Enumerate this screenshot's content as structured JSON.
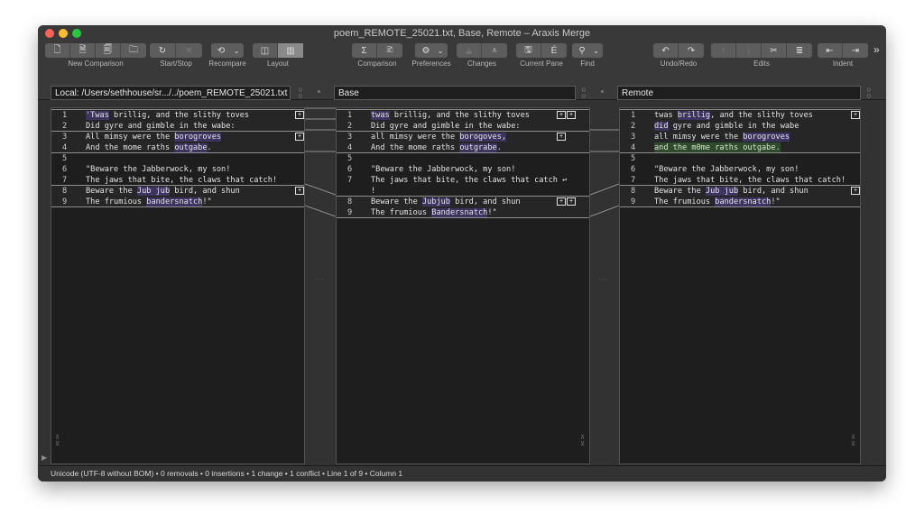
{
  "window": {
    "title": "poem_REMOTE_25021.txt, Base, Remote – Araxis Merge"
  },
  "toolbar": {
    "groups": [
      {
        "label": "New Comparison",
        "icons": [
          "new-text-comparison-icon",
          "new-binary-comparison-icon",
          "new-image-comparison-icon",
          "new-folder-comparison-icon"
        ]
      },
      {
        "label": "Start/Stop",
        "icons": [
          "refresh-icon",
          "stop-icon"
        ]
      },
      {
        "label": "Recompare",
        "icons": [
          "recompare-icon",
          "chevron-down-icon"
        ]
      },
      {
        "label": "Layout",
        "icons": [
          "two-pane-layout-icon",
          "three-pane-layout-icon"
        ]
      },
      {
        "label": "Comparison",
        "icons": [
          "sigma-icon",
          "report-icon"
        ]
      },
      {
        "label": "Preferences",
        "icons": [
          "gear-icon"
        ]
      },
      {
        "label": "Changes",
        "icons": [
          "previous-change-icon",
          "next-change-icon"
        ]
      },
      {
        "label": "Current Pane",
        "icons": [
          "save-icon",
          "edit-icon"
        ]
      },
      {
        "label": "Find",
        "icons": [
          "search-icon"
        ]
      },
      {
        "label": "Undo/Redo",
        "icons": [
          "undo-icon",
          "redo-icon"
        ]
      },
      {
        "label": "Edits",
        "icons": [
          "edit-left-icon",
          "edit-down-icon",
          "cut-icon",
          "wrap-icon"
        ]
      },
      {
        "label": "Indent",
        "icons": [
          "outdent-icon",
          "indent-icon"
        ]
      }
    ],
    "overflow": "»"
  },
  "panes": [
    {
      "path": "Local: /Users/sethhouse/sr.../../poem_REMOTE_25021.txt",
      "lines": [
        {
          "n": "1",
          "text": " 'Twas brillig, and the slithy toves"
        },
        {
          "n": "2",
          "text": "Did gyre and gimble in the wabe:"
        },
        {
          "n": "3",
          "text": "All mimsy were the borogroves"
        },
        {
          "n": "4",
          "text": "And the mome raths outgabe."
        },
        {
          "n": "5",
          "text": ""
        },
        {
          "n": "6",
          "text": "\"Beware the Jabberwock, my son!"
        },
        {
          "n": "7",
          "text": "The jaws that bite, the claws that catch!"
        },
        {
          "n": "8",
          "text": "Beware the Jub jub bird, and shun"
        },
        {
          "n": "9",
          "text": "The frumious bandersnatch!\""
        }
      ]
    },
    {
      "path": "Base",
      "lines": [
        {
          "n": "1",
          "text": "twas brillig, and the slithy toves"
        },
        {
          "n": "2",
          "text": "Did gyre and gimble in the wabe:"
        },
        {
          "n": "3",
          "text": "all mimsy were the borogoves,"
        },
        {
          "n": "4",
          "text": "And the mome raths outgrabe."
        },
        {
          "n": "5",
          "text": ""
        },
        {
          "n": "6",
          "text": "\"Beware the Jabberwock, my son!"
        },
        {
          "n": "7",
          "text": "The jaws that bite, the claws that catch ↩"
        },
        {
          "n": "",
          "text": "!"
        },
        {
          "n": "8",
          "text": "Beware the Jubjub bird, and shun"
        },
        {
          "n": "9",
          "text": "The frumious Bandersnatch!\""
        }
      ]
    },
    {
      "path": "Remote",
      "lines": [
        {
          "n": "1",
          "text": "twas brillig, and the slithy toves"
        },
        {
          "n": "2",
          "text": "did gyre and gimble in the wabe"
        },
        {
          "n": "3",
          "text": "all mimsy were the borogroves"
        },
        {
          "n": "4",
          "text": "and the m0me raths outgabe."
        },
        {
          "n": "5",
          "text": ""
        },
        {
          "n": "6",
          "text": "\"Beware the Jabberwock, my son!"
        },
        {
          "n": "7",
          "text": "The jaws that bite, the claws that catch!"
        },
        {
          "n": "8",
          "text": "Beware the Jub jub bird, and shun"
        },
        {
          "n": "9",
          "text": "The frumious bandersnatch!\""
        }
      ]
    }
  ],
  "status": "Unicode (UTF-8 without BOM) • 0 removals • 0 insertions • 1 change • 1 conflict • Line 1 of 9 • Column 1",
  "colors": {
    "conflict_highlight": "#3e3460",
    "remote_change_highlight": "#2f4a2e",
    "window_background": "#323232",
    "pane_background": "#1e1e1e"
  }
}
